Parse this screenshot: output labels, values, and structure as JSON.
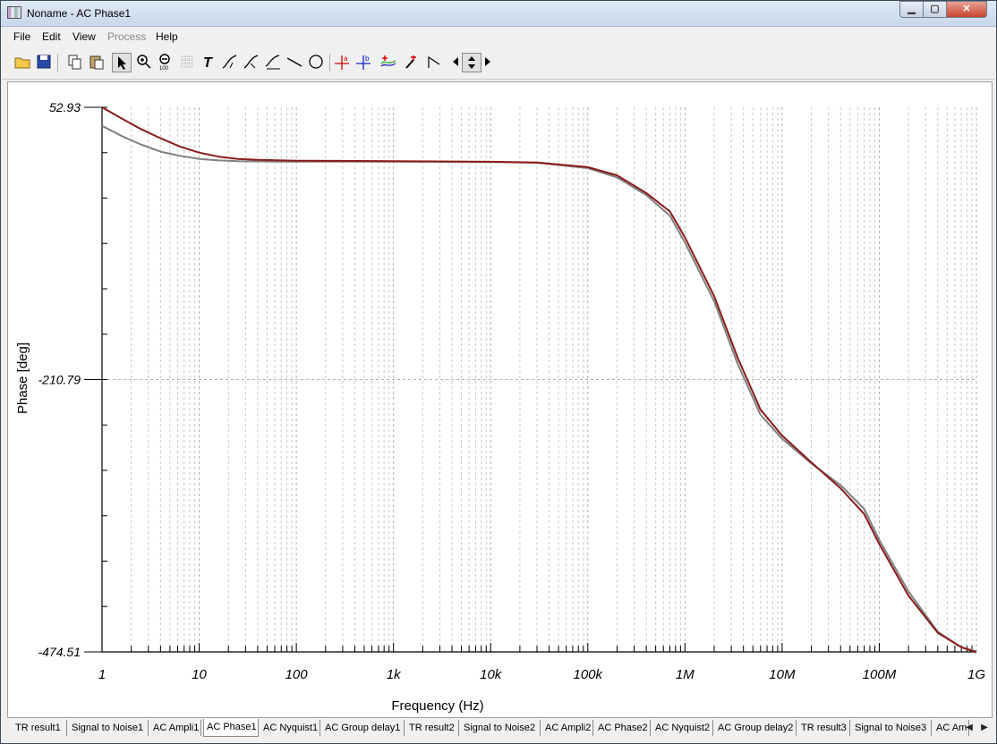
{
  "window": {
    "title": "Noname - AC Phase1",
    "min_glyph": "▁",
    "max_glyph": "▢",
    "close_glyph": "✕"
  },
  "menu": {
    "items": [
      "File",
      "Edit",
      "View",
      "Process",
      "Help"
    ]
  },
  "toolbar": {
    "buttons": [
      "open-icon",
      "save-icon",
      "copy-icon",
      "paste-icon",
      "pointer-icon",
      "zoom-in-icon",
      "zoom-out-icon",
      "zoom-100-icon",
      "grid-icon",
      "text-icon",
      "cursor-a-icon",
      "cursor-b-icon",
      "axis-edit-icon",
      "line-icon",
      "circle-icon",
      "marker-a-icon",
      "marker-b-icon",
      "add-curve-icon",
      "pick-icon",
      "step-icon",
      "nav-left-icon",
      "nav-updown-icon",
      "nav-right-icon"
    ]
  },
  "chart_data": {
    "type": "line",
    "xlabel": "Frequency (Hz)",
    "ylabel": "Phase [deg]",
    "x_scale": "log",
    "xlim": [
      1,
      1000000000
    ],
    "ylim": [
      -474.51,
      52.93
    ],
    "x_tick_labels": [
      "1",
      "10",
      "100",
      "1k",
      "10k",
      "100k",
      "1M",
      "10M",
      "100M",
      "1G"
    ],
    "y_tick_labels": [
      "52.93",
      "-210.79",
      "-474.51"
    ],
    "grid": true,
    "colors": {
      "series1": "#8b1a1a",
      "series2": "#808080"
    },
    "series": [
      {
        "x": [
          1,
          1.6,
          2.5,
          4,
          6.3,
          10,
          16,
          25,
          40,
          63,
          100,
          1000,
          10000,
          30000,
          100000,
          200000,
          400000,
          700000,
          1000000,
          2000000,
          3500000,
          6000000,
          10000000,
          20000000,
          40000000,
          70000000,
          100000000,
          200000000,
          400000000,
          700000000,
          1000000000
        ],
        "values": [
          52.9,
          42,
          32,
          23,
          15,
          9,
          5,
          3,
          2,
          1.6,
          1.2,
          0.8,
          0.2,
          -0.5,
          -5,
          -13,
          -30,
          -48,
          -73,
          -130,
          -190,
          -240,
          -265,
          -291,
          -316,
          -341,
          -370,
          -420,
          -456,
          -470,
          -475
        ]
      },
      {
        "x": [
          1,
          1.6,
          2.5,
          4,
          6.3,
          10,
          16,
          25,
          40,
          63,
          100,
          1000,
          10000,
          30000,
          100000,
          200000,
          400000,
          700000,
          1000000,
          2000000,
          3500000,
          6000000,
          10000000,
          20000000,
          40000000,
          70000000,
          100000000,
          200000000,
          400000000,
          700000000,
          1000000000
        ],
        "values": [
          35,
          25,
          17,
          10,
          6,
          3,
          1.5,
          0.8,
          0.5,
          0.4,
          0.4,
          0.4,
          0,
          -0.8,
          -6,
          -15,
          -32,
          -52,
          -78,
          -135,
          -196,
          -245,
          -268,
          -292,
          -313,
          -336,
          -366,
          -416,
          -455,
          -470,
          -474
        ]
      }
    ]
  },
  "tabs": {
    "items": [
      "TR result1",
      "Signal to Noise1",
      "AC Ampli1",
      "AC Phase1",
      "AC Nyquist1",
      "AC Group delay1",
      "TR result2",
      "Signal to Noise2",
      "AC Ampli2",
      "AC Phase2",
      "AC Nyquist2",
      "AC Group delay2",
      "TR result3",
      "Signal to Noise3",
      "AC Am"
    ],
    "active": 3,
    "left_arrow": "◀",
    "right_arrow": "▶"
  }
}
